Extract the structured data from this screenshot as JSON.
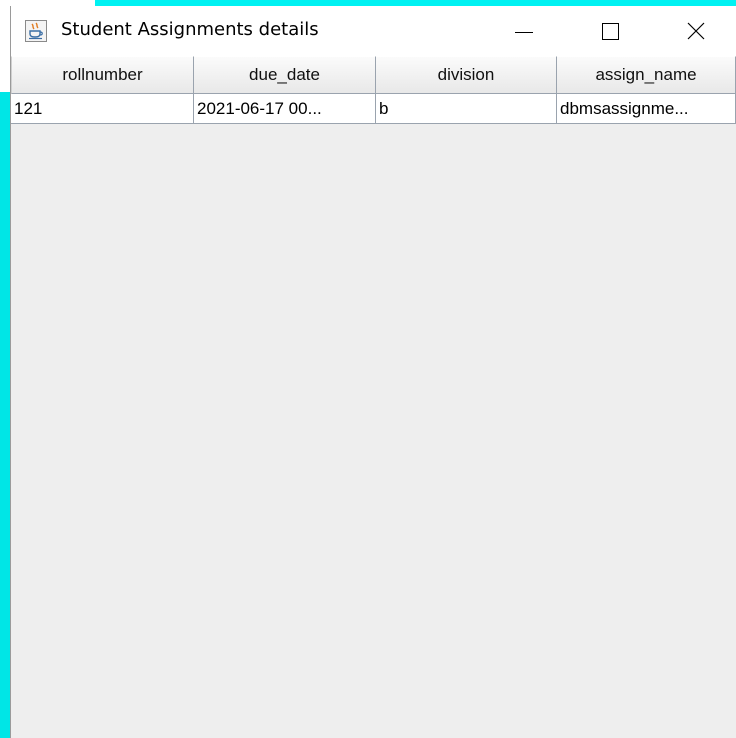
{
  "window": {
    "title": "Student Assignments details",
    "app_icon": "java-coffee-cup-icon",
    "controls": {
      "minimize": "minimize-icon",
      "maximize": "maximize-icon",
      "close": "close-icon"
    }
  },
  "table": {
    "columns": [
      "rollnumber",
      "due_date",
      "division",
      "assign_name"
    ],
    "rows": [
      [
        "121",
        "2021-06-17 00...",
        "b",
        "dbmsassignme..."
      ]
    ]
  },
  "colors": {
    "background_accent": "#00f2f2",
    "table_area": "#eeeeee",
    "grid_line": "#9aa3ae"
  }
}
